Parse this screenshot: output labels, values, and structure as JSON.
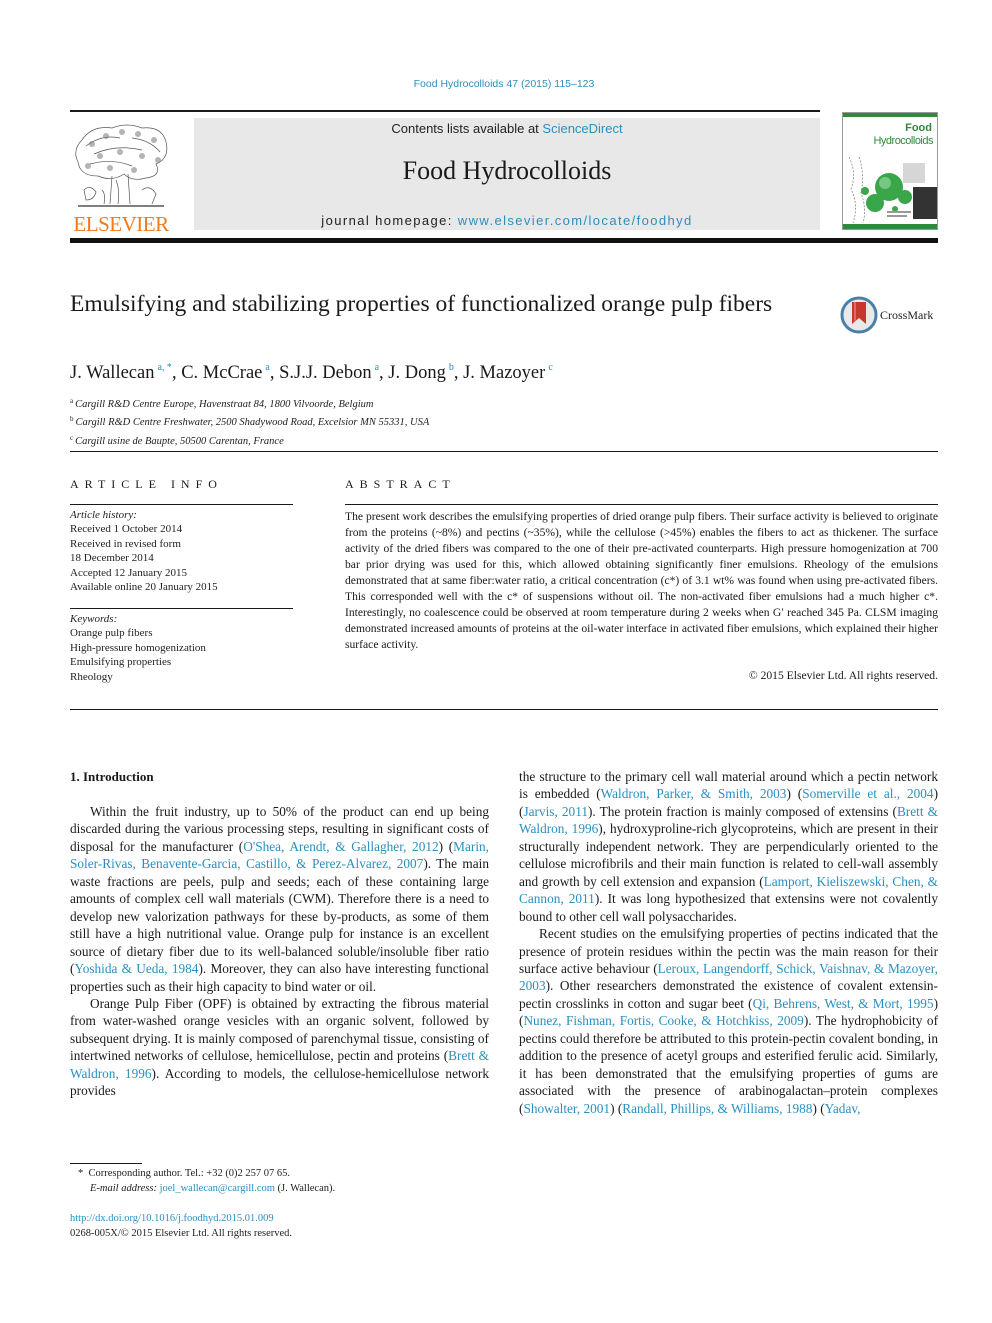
{
  "header": {
    "citation": "Food Hydrocolloids 47 (2015) 115–123",
    "contents_prefix": "Contents lists available at ",
    "contents_link": "ScienceDirect",
    "journal_title": "Food Hydrocolloids",
    "homepage_prefix": "journal homepage: ",
    "homepage_link": "www.elsevier.com/locate/foodhyd",
    "publisher_logo_text": "ELSEVIER",
    "cover": {
      "line1": "Food",
      "line2": "Hydrocolloids"
    },
    "colors": {
      "link": "#2a8fbf",
      "elsevier_orange": "#f07a1a",
      "cover_green": "#2e8b3c",
      "header_box": "#e8e8e8"
    }
  },
  "article": {
    "title": "Emulsifying and stabilizing properties of functionalized orange pulp fibers",
    "crossmark_label": "CrossMark",
    "authors": [
      {
        "name": "J. Wallecan",
        "sup": "a, *"
      },
      {
        "name": "C. McCrae",
        "sup": "a"
      },
      {
        "name": "S.J.J. Debon",
        "sup": "a"
      },
      {
        "name": "J. Dong",
        "sup": "b"
      },
      {
        "name": "J. Mazoyer",
        "sup": "c"
      }
    ],
    "affiliations": [
      {
        "key": "a",
        "text": "Cargill R&D Centre Europe, Havenstraat 84, 1800 Vilvoorde, Belgium"
      },
      {
        "key": "b",
        "text": "Cargill R&D Centre Freshwater, 2500 Shadywood Road, Excelsior MN 55331, USA"
      },
      {
        "key": "c",
        "text": "Cargill usine de Baupte, 50500 Carentan, France"
      }
    ]
  },
  "article_info": {
    "heading": "ARTICLE INFO",
    "history_label": "Article history:",
    "history": [
      "Received 1 October 2014",
      "Received in revised form",
      "18 December 2014",
      "Accepted 12 January 2015",
      "Available online 20 January 2015"
    ],
    "keywords_label": "Keywords:",
    "keywords": [
      "Orange pulp fibers",
      "High-pressure homogenization",
      "Emulsifying properties",
      "Rheology"
    ]
  },
  "abstract": {
    "heading": "ABSTRACT",
    "text": "The present work describes the emulsifying properties of dried orange pulp fibers. Their surface activity is believed to originate from the proteins (~8%) and pectins (~35%), while the cellulose (>45%) enables the fibers to act as thickener. The surface activity of the dried fibers was compared to the one of their pre-activated counterparts. High pressure homogenization at 700 bar prior drying was used for this, which allowed obtaining significantly finer emulsions. Rheology of the emulsions demonstrated that at same fiber:water ratio, a critical concentration (c*) of 3.1 wt% was found when using pre-activated fibers. This corresponded well with the c* of suspensions without oil. The non-activated fiber emulsions had a much higher c*. Interestingly, no coalescence could be observed at room temperature during 2 weeks when G′ reached 345 Pa. CLSM imaging demonstrated increased amounts of proteins at the oil-water interface in activated fiber emulsions, which explained their higher surface activity.",
    "copyright": "© 2015 Elsevier Ltd. All rights reserved."
  },
  "body": {
    "section_heading": "1.  Introduction",
    "left_col": [
      {
        "indent": true,
        "parts": [
          {
            "t": "Within the fruit industry, up to 50% of the product can end up being discarded during the various processing steps, resulting in significant costs of disposal for the manufacturer ("
          },
          {
            "t": "O'Shea, Arendt, & Gallagher, 2012",
            "link": true
          },
          {
            "t": ") ("
          },
          {
            "t": "Marin, Soler-Rivas, Benavente-Garcia, Castillo, & Perez-Alvarez, 2007",
            "link": true
          },
          {
            "t": "). The main waste fractions are peels, pulp and seeds; each of these containing large amounts of complex cell wall materials (CWM). Therefore there is a need to develop new valorization pathways for these by-products, as some of them still have a high nutritional value. Orange pulp for instance is an excellent source of dietary fiber due to its well-balanced soluble/insoluble fiber ratio ("
          },
          {
            "t": "Yoshida & Ueda, 1984",
            "link": true
          },
          {
            "t": "). Moreover, they can also have interesting functional properties such as their high capacity to bind water or oil."
          }
        ]
      },
      {
        "indent": true,
        "parts": [
          {
            "t": "Orange Pulp Fiber (OPF) is obtained by extracting the fibrous material from water-washed orange vesicles with an organic solvent, followed by subsequent drying. It is mainly composed of parenchymal tissue, consisting of intertwined networks of cellulose, hemicellulose, pectin and proteins ("
          },
          {
            "t": "Brett & Waldron, 1996",
            "link": true
          },
          {
            "t": "). According to models, the cellulose-hemicellulose network provides"
          }
        ]
      }
    ],
    "right_col": [
      {
        "indent": false,
        "parts": [
          {
            "t": "the structure to the primary cell wall material around which a pectin network is embedded ("
          },
          {
            "t": "Waldron, Parker, & Smith, 2003",
            "link": true
          },
          {
            "t": ") ("
          },
          {
            "t": "Somerville et al., 2004",
            "link": true
          },
          {
            "t": ")("
          },
          {
            "t": "Jarvis, 2011",
            "link": true
          },
          {
            "t": "). The protein fraction is mainly composed of extensins ("
          },
          {
            "t": "Brett & Waldron, 1996",
            "link": true
          },
          {
            "t": "), hydroxyproline-rich glycoproteins, which are present in their structurally independent network. They are perpendicularly oriented to the cellulose microfibrils and their main function is related to cell-wall assembly and growth by cell extension and expansion ("
          },
          {
            "t": "Lamport, Kieliszewski, Chen, & Cannon, 2011",
            "link": true
          },
          {
            "t": "). It was long hypothesized that extensins were not covalently bound to other cell wall polysaccharides."
          }
        ]
      },
      {
        "indent": true,
        "parts": [
          {
            "t": "Recent studies on the emulsifying properties of pectins indicated that the presence of protein residues within the pectin was the main reason for their surface active behaviour ("
          },
          {
            "t": "Leroux, Langendorff, Schick, Vaishnav, & Mazoyer, 2003",
            "link": true
          },
          {
            "t": "). Other researchers demonstrated the existence of covalent extensin-pectin crosslinks in cotton and sugar beet ("
          },
          {
            "t": "Qi, Behrens, West, & Mort, 1995",
            "link": true
          },
          {
            "t": ") ("
          },
          {
            "t": "Nunez, Fishman, Fortis, Cooke, & Hotchkiss, 2009",
            "link": true
          },
          {
            "t": "). The hydrophobicity of pectins could therefore be attributed to this protein-pectin covalent bonding, in addition to the presence of acetyl groups and esterified ferulic acid. Similarly, it has been demonstrated that the emulsifying properties of gums are associated with the presence of arabinogalactan–protein complexes ("
          },
          {
            "t": "Showalter, 2001",
            "link": true
          },
          {
            "t": ") ("
          },
          {
            "t": "Randall, Phillips, & Williams, 1988",
            "link": true
          },
          {
            "t": ") ("
          },
          {
            "t": "Yadav,",
            "link": true
          }
        ]
      }
    ]
  },
  "footnote": {
    "marker": "*",
    "corresponding": "Corresponding author. Tel.: +32 (0)2 257 07 65.",
    "email_label": "E-mail address: ",
    "email": "joel_wallecan@cargill.com",
    "email_suffix": " (J. Wallecan)."
  },
  "doi": {
    "url": "http://dx.doi.org/10.1016/j.foodhyd.2015.01.009",
    "issn_line": "0268-005X/© 2015 Elsevier Ltd. All rights reserved."
  }
}
